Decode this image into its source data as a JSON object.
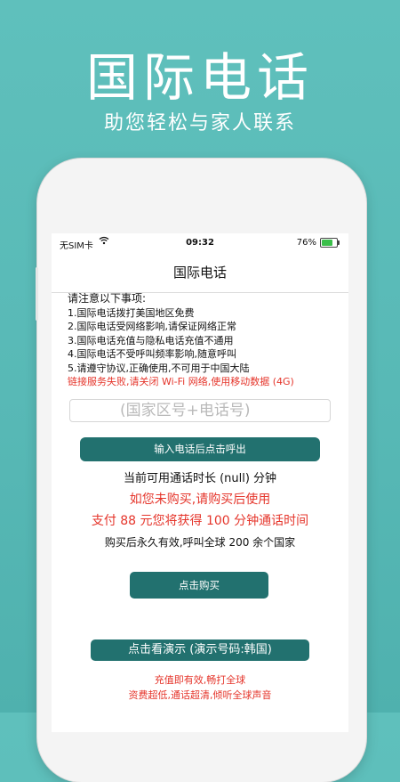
{
  "hero": {
    "title": "国际电话",
    "subtitle": "助您轻松与家人联系"
  },
  "status_bar": {
    "carrier": "无SIM卡",
    "wifi_icon": "wifi-icon",
    "time": "09:32",
    "battery_percent": "76%",
    "battery_level": 0.76,
    "battery_color": "#3bbf4a"
  },
  "navbar": {
    "title": "国际电话"
  },
  "notice": {
    "heading": "请注意以下事项:",
    "items": [
      "1.国际电话拨打美国地区免费",
      "2.国际电话受网络影响,请保证网络正常",
      "3.国际电话充值与隐私电话充值不通用",
      "4.国际电话不受呼叫频率影响,随意呼叫",
      "5.请遵守协议,正确使用,不可用于中国大陆"
    ],
    "warning": "链接服务失败,请关闭 Wi-Fi 网络,使用移动数据 (4G)"
  },
  "dial": {
    "placeholder": "(国家区号+电话号)",
    "call_button": "输入电话后点击呼出"
  },
  "info": {
    "duration": "当前可用通话时长 (null) 分钟",
    "buy_prompt": "如您未购买,请购买后使用",
    "offer": "支付 88 元您将获得 100 分钟通话时间",
    "validity": "购买后永久有效,呼叫全球 200 余个国家"
  },
  "buy": {
    "button": "点击购买"
  },
  "demo": {
    "button": "点击看演示 (演示号码:韩国)"
  },
  "promo": {
    "line1": "充值即有效,畅打全球",
    "line2": "资费超低,通话超清,倾听全球声音"
  },
  "colors": {
    "background": "#58b9b6",
    "button": "#22716f",
    "warning": "#e5352b"
  }
}
